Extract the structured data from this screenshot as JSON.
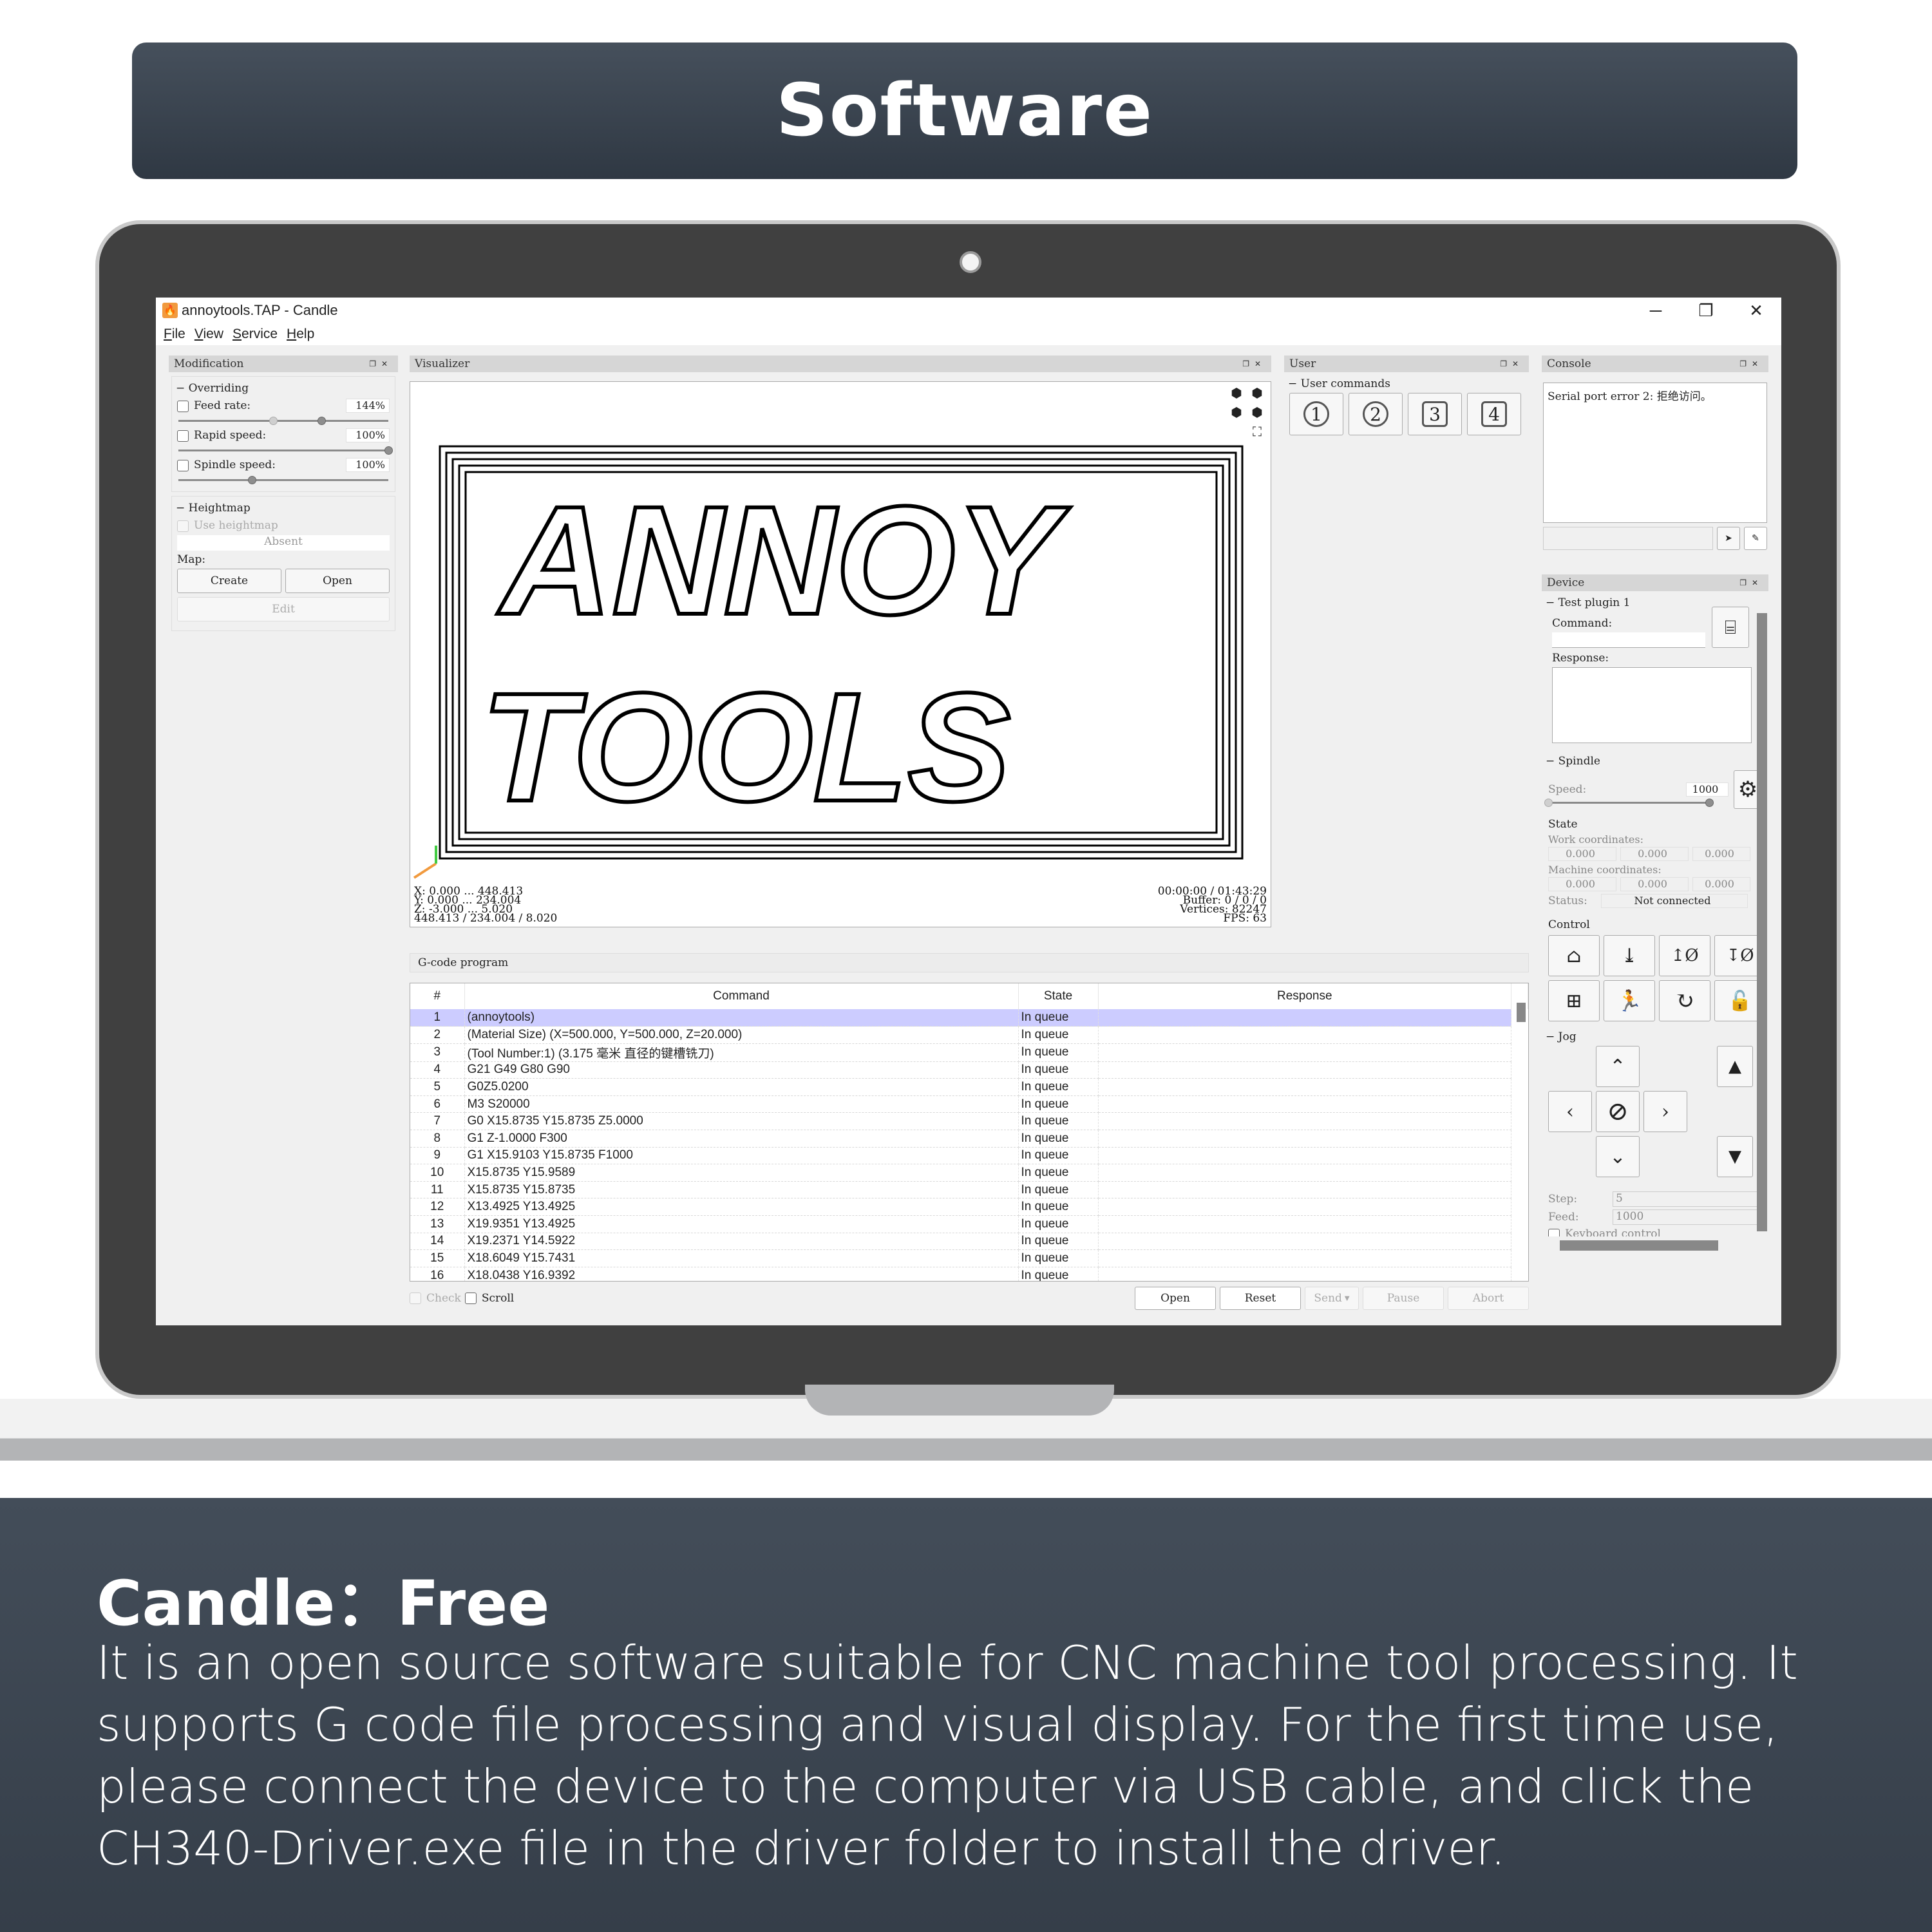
{
  "banner": {
    "title": "Software"
  },
  "window": {
    "title": "annoytools.TAP - Candle",
    "app_icon": "candle-flame-icon",
    "controls": {
      "minimize": "─",
      "restore": "❐",
      "close": "✕"
    },
    "menu": [
      "File",
      "View",
      "Service",
      "Help"
    ]
  },
  "modification": {
    "title": "Modification",
    "overriding": {
      "label": "Overriding",
      "feed_rate": {
        "label": "Feed rate:",
        "value": "144%",
        "slider_fraction": 0.68,
        "ghost_fraction": 0.45
      },
      "rapid_speed": {
        "label": "Rapid speed:",
        "value": "100%",
        "slider_fraction": 1.0
      },
      "spindle_speed": {
        "label": "Spindle speed:",
        "value": "100%",
        "slider_fraction": 0.35
      }
    },
    "heightmap": {
      "label": "Heightmap",
      "use_label": "Use heightmap",
      "status": "Absent",
      "map_label": "Map:",
      "create": "Create",
      "open": "Open",
      "edit": "Edit"
    }
  },
  "visualizer": {
    "title": "Visualizer",
    "readout_left": [
      "X: 0.000 ... 448.413",
      "Y: 0.000 ... 234.004",
      "Z: -3.000 ... 5.020",
      "448.413 / 234.004 / 8.020"
    ],
    "readout_right": [
      "00:00:00 / 01:43:29",
      "Buffer: 0 / 0 / 0",
      "Vertices: 82247",
      "FPS: 63"
    ],
    "toolpath_text": [
      "ANNOY",
      "TOOLS"
    ]
  },
  "user": {
    "title": "User",
    "group": "User commands",
    "buttons": [
      "1",
      "2",
      "3",
      "4"
    ]
  },
  "console": {
    "title": "Console",
    "log": "Serial port error 2: 拒绝访问。",
    "input_value": ""
  },
  "device": {
    "title": "Device",
    "plugin": {
      "label": "Test plugin 1",
      "command_label": "Command:",
      "response_label": "Response:"
    },
    "spindle": {
      "label": "Spindle",
      "speed_label": "Speed:",
      "speed_value": "1000",
      "slider_fraction": 1.0
    },
    "state": {
      "label": "State",
      "work_label": "Work coordinates:",
      "work": [
        "0.000",
        "0.000",
        "0.000"
      ],
      "machine_label": "Machine coordinates:",
      "machine": [
        "0.000",
        "0.000",
        "0.000"
      ],
      "status_label": "Status:",
      "status_value": "Not connected"
    },
    "control": {
      "label": "Control"
    },
    "jog": {
      "label": "Jog",
      "step_label": "Step:",
      "step_value": "5",
      "feed_label": "Feed:",
      "feed_value": "1000",
      "keyboard_label": "Keyboard control"
    }
  },
  "gcode": {
    "title": "G-code program",
    "columns": [
      "#",
      "Command",
      "State",
      "Response"
    ],
    "rows": [
      {
        "n": "1",
        "cmd": "(annoytools)",
        "state": "In queue",
        "resp": ""
      },
      {
        "n": "2",
        "cmd": "(Material Size) (X=500.000, Y=500.000, Z=20.000)",
        "state": "In queue",
        "resp": ""
      },
      {
        "n": "3",
        "cmd": "(Tool Number:1) (3.175 毫米 直径的键槽铣刀)",
        "state": "In queue",
        "resp": ""
      },
      {
        "n": "4",
        "cmd": "G21 G49 G80 G90",
        "state": "In queue",
        "resp": ""
      },
      {
        "n": "5",
        "cmd": "G0Z5.0200",
        "state": "In queue",
        "resp": ""
      },
      {
        "n": "6",
        "cmd": "M3 S20000",
        "state": "In queue",
        "resp": ""
      },
      {
        "n": "7",
        "cmd": "G0 X15.8735 Y15.8735 Z5.0000",
        "state": "In queue",
        "resp": ""
      },
      {
        "n": "8",
        "cmd": "G1   Z-1.0000 F300",
        "state": "In queue",
        "resp": ""
      },
      {
        "n": "9",
        "cmd": "G1 X15.9103 Y15.8735  F1000",
        "state": "In queue",
        "resp": ""
      },
      {
        "n": "10",
        "cmd": "X15.8735 Y15.9589",
        "state": "In queue",
        "resp": ""
      },
      {
        "n": "11",
        "cmd": "X15.8735 Y15.8735",
        "state": "In queue",
        "resp": ""
      },
      {
        "n": "12",
        "cmd": "X13.4925 Y13.4925",
        "state": "In queue",
        "resp": ""
      },
      {
        "n": "13",
        "cmd": "X19.9351 Y13.4925",
        "state": "In queue",
        "resp": ""
      },
      {
        "n": "14",
        "cmd": "X19.2371 Y14.5922",
        "state": "In queue",
        "resp": ""
      },
      {
        "n": "15",
        "cmd": "X18.6049 Y15.7431",
        "state": "In queue",
        "resp": ""
      },
      {
        "n": "16",
        "cmd": "X18.0438 Y16.9392",
        "state": "In queue",
        "resp": ""
      }
    ],
    "selected_row": 1,
    "check_label": "Check",
    "scroll_label": "Scroll",
    "buttons": {
      "open": "Open",
      "reset": "Reset",
      "send": "Send",
      "pause": "Pause",
      "abort": "Abort"
    }
  },
  "footer": {
    "heading": "Candle：Free",
    "body": "It is an open source software suitable for CNC machine tool processing. It supports G code file processing and visual display. For the first time use, please connect the device to the computer via USB cable, and click the CH340-Driver.exe file in the driver folder to install the driver."
  },
  "colors": {
    "banner": "#3b4450",
    "selected_row": "#ccccff",
    "app_icon": "#f19a3e",
    "bezel": "#404040"
  }
}
